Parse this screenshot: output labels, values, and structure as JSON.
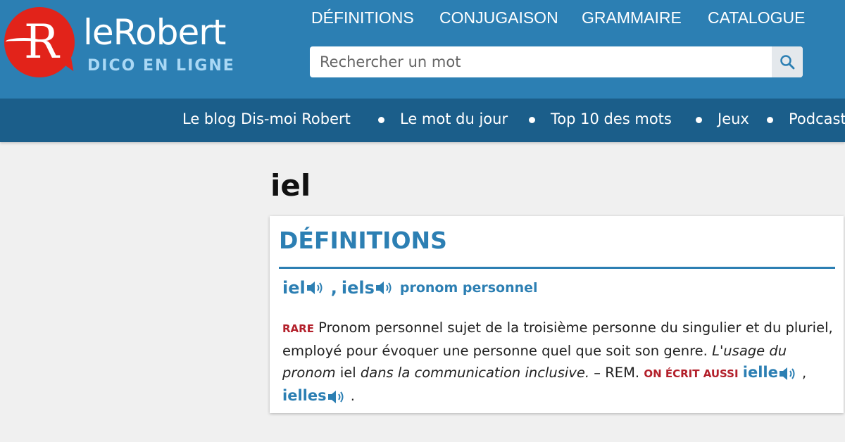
{
  "brand": {
    "logo_letter": "R",
    "name": "leRobert",
    "subtitle": "DICO EN LIGNE",
    "colors": {
      "primary": "#2c7fb3",
      "dark": "#1b5e8a",
      "logo_red": "#e2231a",
      "tag_red": "#b3202b"
    }
  },
  "topnav": {
    "items": [
      "DÉFINITIONS",
      "CONJUGAISON",
      "GRAMMAIRE",
      "CATALOGUE"
    ]
  },
  "search": {
    "placeholder": "Rechercher un mot",
    "value": "",
    "icon": "search-icon"
  },
  "subnav": {
    "items": [
      "Le blog Dis-moi Robert",
      "Le mot du jour",
      "Top 10 des mots",
      "Jeux",
      "Podcast"
    ]
  },
  "entry": {
    "word": "iel",
    "section_heading": "DÉFINITIONS",
    "headword": "iel",
    "headword_plural": "iels",
    "separator": ",",
    "part_of_speech": "pronom personnel",
    "definition": {
      "tag": "RARE",
      "text": "Pronom personnel sujet de la troisième personne du singulier et du pluriel, employé pour évoquer une personne quel que soit son genre.",
      "example_pre": "L'usage du pronom",
      "example_word": "iel",
      "example_post": "dans la communication inclusive.",
      "rem": "– REM.",
      "variant_tag": "ON ÉCRIT AUSSI",
      "variant_1": "ielle",
      "variant_sep": ",",
      "variant_2": "ielles",
      "end": "."
    }
  }
}
